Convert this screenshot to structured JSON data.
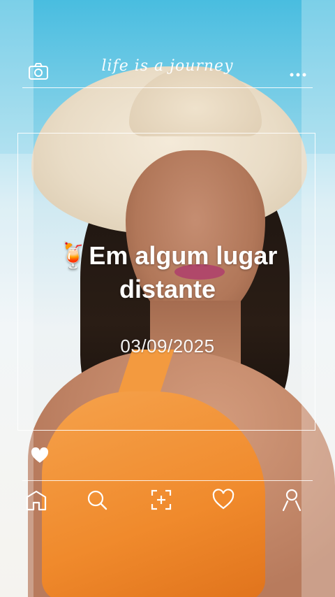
{
  "header": {
    "brand": "life is a journey",
    "icons": [
      "camera-icon",
      "more-icon"
    ]
  },
  "post": {
    "caption_emoji": "🍹",
    "caption_line1": "Em algum lugar",
    "caption_line2": "distante",
    "date": "03/09/2025"
  },
  "actions": {
    "like_icon": "heart-filled-icon"
  },
  "nav": {
    "items": [
      "home-icon",
      "search-icon",
      "scan-add-icon",
      "heart-icon",
      "profile-icon"
    ]
  }
}
